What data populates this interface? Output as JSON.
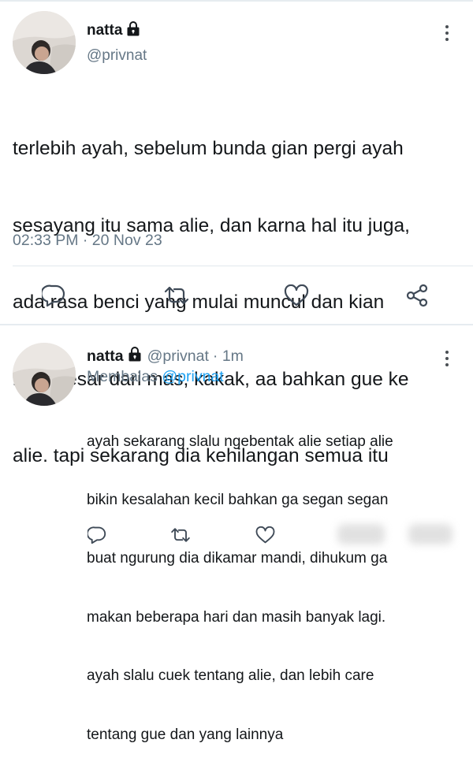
{
  "main_tweet": {
    "author": {
      "name": "natta",
      "handle": "@privnat",
      "avatar": "avatar-photo",
      "protected": "lock-icon"
    },
    "text_lines": [
      "terlebih ayah, sebelum bunda gian pergi ayah",
      "sesayang itu sama alie, dan karna hal itu juga,",
      "ada rasa benci yang mulai muncul dan kian",
      "membesar dari mas, kakak, aa bahkan gue ke",
      "alie. tapi sekarang dia kehilangan semua itu"
    ],
    "timestamp": "02:33 PM · 20 Nov 23",
    "actions": [
      "reply-icon",
      "retweet-icon",
      "like-icon",
      "share-icon"
    ]
  },
  "reply_tweet": {
    "author": {
      "name": "natta",
      "handle": "@privnat",
      "time": "· 1m"
    },
    "replying_label": "Membalas",
    "replying_to": "@privnat",
    "text_lines": [
      "ayah sekarang slalu ngebentak alie setiap alie",
      "bikin kesalahan kecil bahkan ga segan segan",
      "buat ngurung dia dikamar mandi, dihukum ga",
      "makan beberapa hari dan masih banyak lagi.",
      "ayah slalu cuek tentang alie, dan lebih care",
      "tentang gue dan yang lainnya"
    ],
    "actions": [
      "reply-icon",
      "retweet-icon",
      "like-icon",
      "share-icon"
    ]
  },
  "colors": {
    "text": "#14171a",
    "muted": "#657786",
    "link": "#1da1f2",
    "divider": "#e1e8ed",
    "icon": "#3f4a57"
  }
}
